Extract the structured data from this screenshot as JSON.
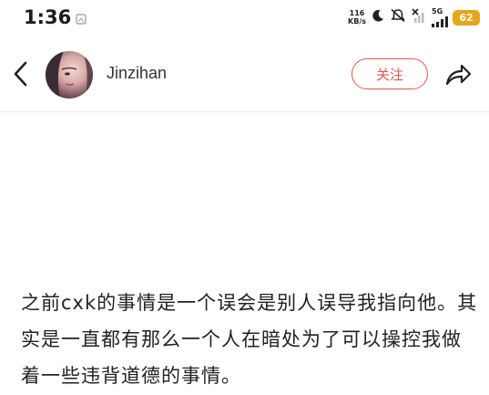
{
  "status_bar": {
    "time": "1:36",
    "network_speed_value": "116",
    "network_speed_unit": "KB/s",
    "network_type": "5G",
    "battery_level": "62",
    "battery_color": "#e7a51d"
  },
  "header": {
    "username": "Jinzihan",
    "follow_label": "关注",
    "accent_color": "#e6564f"
  },
  "post": {
    "text": "之前cxk的事情是一个误会是别人误导我指向他。其实是一直都有那么一个人在暗处为了可以操控我做着一些违背道德的事情。"
  },
  "icons": [
    "gallery-icon",
    "moon-icon",
    "mute-icon",
    "wifi-off-icon",
    "signal-icon",
    "back-arrow-icon",
    "share-icon"
  ]
}
